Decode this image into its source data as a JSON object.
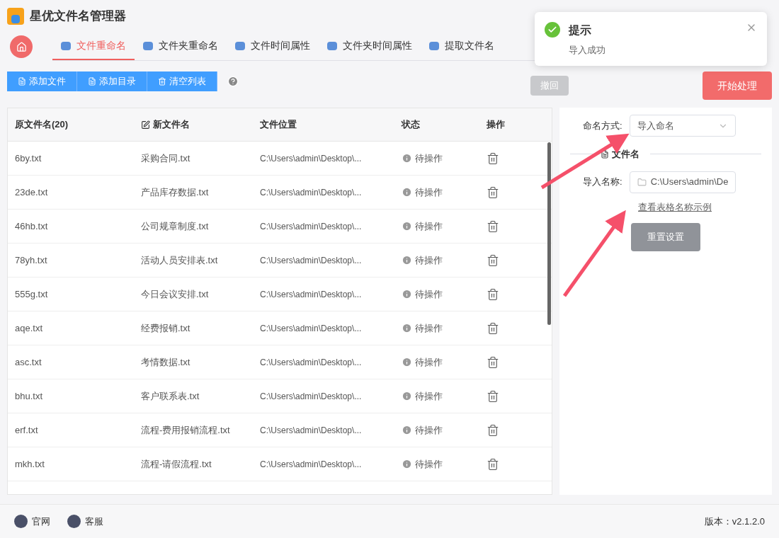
{
  "app": {
    "title": "星优文件名管理器"
  },
  "tabs": [
    {
      "label": "文件重命名",
      "selected": true
    },
    {
      "label": "文件夹重命名",
      "selected": false
    },
    {
      "label": "文件时间属性",
      "selected": false
    },
    {
      "label": "文件夹时间属性",
      "selected": false
    },
    {
      "label": "提取文件名",
      "selected": false
    }
  ],
  "toolbar": {
    "buttons": [
      "添加文件",
      "添加目录",
      "清空列表"
    ],
    "undo": "撤回",
    "start": "开始处理"
  },
  "table": {
    "columns": [
      "原文件名(20)",
      "新文件名",
      "文件位置",
      "状态",
      "操作"
    ],
    "rows": [
      {
        "original": "6by.txt",
        "new": "采购合同.txt",
        "location": "C:\\Users\\admin\\Desktop\\...",
        "status": "待操作"
      },
      {
        "original": "23de.txt",
        "new": "产品库存数据.txt",
        "location": "C:\\Users\\admin\\Desktop\\...",
        "status": "待操作"
      },
      {
        "original": "46hb.txt",
        "new": "公司规章制度.txt",
        "location": "C:\\Users\\admin\\Desktop\\...",
        "status": "待操作"
      },
      {
        "original": "78yh.txt",
        "new": "活动人员安排表.txt",
        "location": "C:\\Users\\admin\\Desktop\\...",
        "status": "待操作"
      },
      {
        "original": "555g.txt",
        "new": "今日会议安排.txt",
        "location": "C:\\Users\\admin\\Desktop\\...",
        "status": "待操作"
      },
      {
        "original": "aqe.txt",
        "new": "经费报销.txt",
        "location": "C:\\Users\\admin\\Desktop\\...",
        "status": "待操作"
      },
      {
        "original": "asc.txt",
        "new": "考情数据.txt",
        "location": "C:\\Users\\admin\\Desktop\\...",
        "status": "待操作"
      },
      {
        "original": "bhu.txt",
        "new": "客户联系表.txt",
        "location": "C:\\Users\\admin\\Desktop\\...",
        "status": "待操作"
      },
      {
        "original": "erf.txt",
        "new": "流程-费用报销流程.txt",
        "location": "C:\\Users\\admin\\Desktop\\...",
        "status": "待操作"
      },
      {
        "original": "mkh.txt",
        "new": "流程-请假流程.txt",
        "location": "C:\\Users\\admin\\Desktop\\...",
        "status": "待操作"
      }
    ]
  },
  "settings": {
    "mode_label": "命名方式:",
    "mode_value": "导入命名",
    "section": "文件名",
    "import_label": "导入名称:",
    "import_value": "C:\\Users\\admin\\De",
    "example_link": "查看表格名称示例",
    "reset": "重置设置"
  },
  "toast": {
    "title": "提示",
    "message": "导入成功"
  },
  "footer": {
    "links": [
      "官网",
      "客服"
    ],
    "version": "版本：v2.1.2.0"
  }
}
